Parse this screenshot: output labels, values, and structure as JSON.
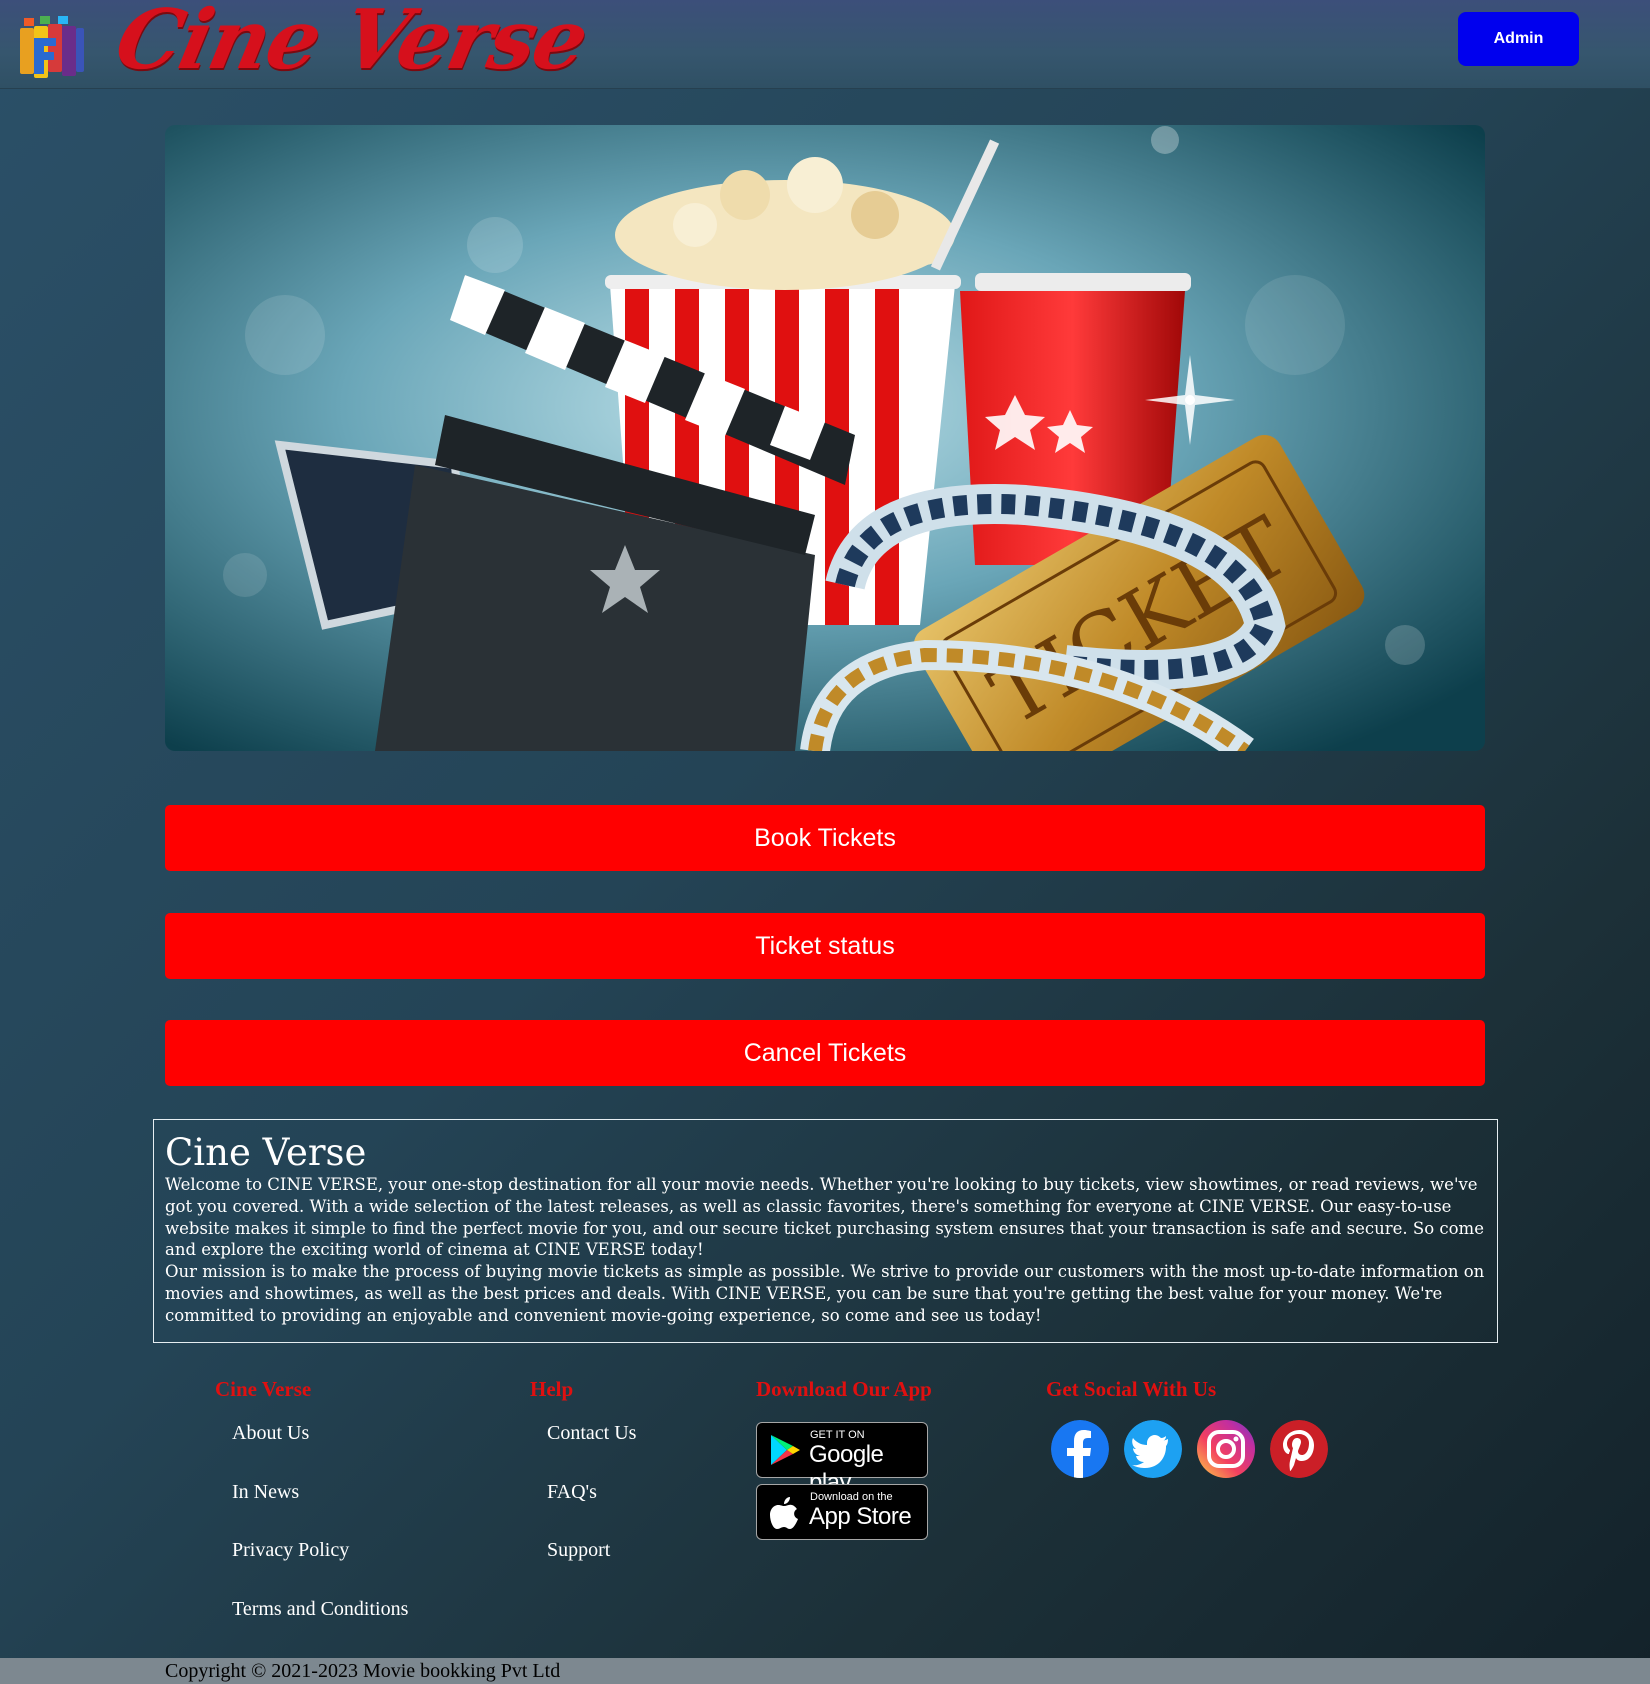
{
  "header": {
    "brand": "Cine Verse",
    "admin_label": "Admin"
  },
  "hero": {
    "ticket_text": "TICKET"
  },
  "actions": {
    "book": "Book Tickets",
    "status": "Ticket status",
    "cancel": "Cancel Tickets"
  },
  "about": {
    "title": "Cine Verse",
    "para1": "Welcome to CINE VERSE, your one-stop destination for all your movie needs. Whether you're looking to buy tickets, view showtimes, or read reviews, we've got you covered. With a wide selection of the latest releases, as well as classic favorites, there's something for everyone at CINE VERSE. Our easy-to-use website makes it simple to find the perfect movie for you, and our secure ticket purchasing system ensures that your transaction is safe and secure. So come and explore the exciting world of cinema at CINE VERSE today!",
    "para2": "Our mission is to make the process of buying movie tickets as simple as possible. We strive to provide our customers with the most up-to-date information on movies and showtimes, as well as the best prices and deals. With CINE VERSE, you can be sure that you're getting the best value for your money. We're committed to providing an enjoyable and convenient movie-going experience, so come and see us today!"
  },
  "footer": {
    "col1": {
      "heading": "Cine Verse",
      "links": [
        "About Us",
        "In News",
        "Privacy Policy",
        "Terms and Conditions"
      ]
    },
    "col2": {
      "heading": "Help",
      "links": [
        "Contact Us",
        "FAQ's",
        "Support"
      ]
    },
    "col3": {
      "heading": "Download Our App",
      "google": {
        "small": "GET IT ON",
        "big": "Google play"
      },
      "apple": {
        "small": "Download on the",
        "big": "App Store"
      }
    },
    "col4": {
      "heading": "Get Social With Us",
      "icons": [
        "facebook-icon",
        "twitter-icon",
        "instagram-icon",
        "pinterest-icon"
      ]
    },
    "copyright": "Copyright © 2021-2023 Movie bookking Pvt Ltd"
  },
  "colors": {
    "brand_red": "#d6101c",
    "button_red": "#ff0000",
    "admin_blue": "#0000ee",
    "footer_heading": "#e01010"
  }
}
